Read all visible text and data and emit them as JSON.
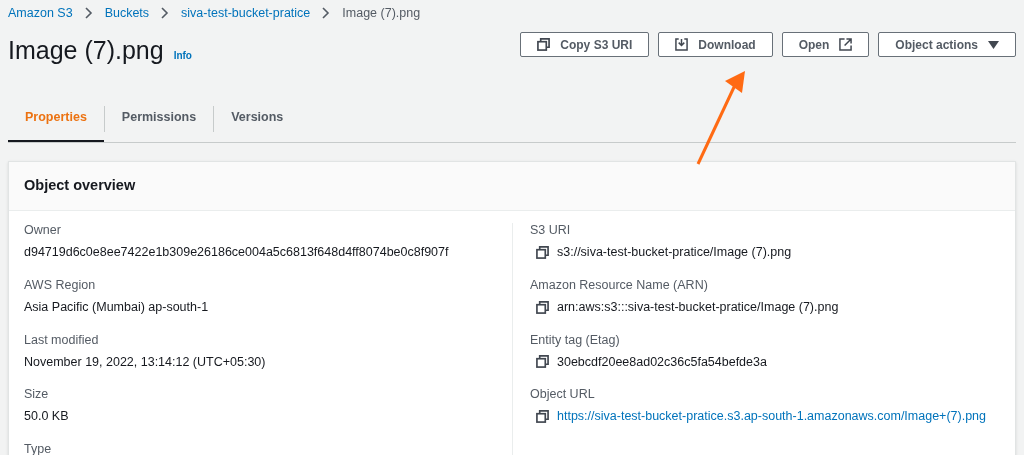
{
  "breadcrumbs": [
    {
      "label": "Amazon S3",
      "kind": "link"
    },
    {
      "label": "Buckets",
      "kind": "link"
    },
    {
      "label": "siva-test-bucket-pratice",
      "kind": "link"
    },
    {
      "label": "Image (7).png",
      "kind": "current"
    }
  ],
  "title": "Image (7).png",
  "info": "Info",
  "actions": [
    {
      "label": "Copy S3 URI"
    },
    {
      "label": "Download"
    },
    {
      "label": "Open"
    },
    {
      "label": "Object actions"
    }
  ],
  "tabs": [
    {
      "label": "Properties",
      "selected": true
    },
    {
      "label": "Permissions",
      "selected": false
    },
    {
      "label": "Versions",
      "selected": false
    }
  ],
  "overview": {
    "title": "Object overview",
    "left": [
      {
        "label": "Owner",
        "value": "d94719d6c0e8ee7422e1b309e26186ce004a5c6813f648d4ff8074be0c8f907f"
      },
      {
        "label": "AWS Region",
        "value": "Asia Pacific (Mumbai) ap-south-1"
      },
      {
        "label": "Last modified",
        "value": "November 19, 2022, 13:14:12 (UTC+05:30)"
      },
      {
        "label": "Size",
        "value": "50.0 KB"
      },
      {
        "label": "Type"
      }
    ],
    "right": [
      {
        "label": "S3 URI",
        "value": "s3://siva-test-bucket-pratice/Image (7).png",
        "kind": "copy"
      },
      {
        "label": "Amazon Resource Name (ARN)",
        "value": "arn:aws:s3:::siva-test-bucket-pratice/Image (7).png",
        "kind": "copy"
      },
      {
        "label": "Entity tag (Etag)",
        "value": "30ebcdf20ee8ad02c36c5fa54befde3a",
        "kind": "copy"
      },
      {
        "label": "Object URL",
        "value": "https://siva-test-bucket-pratice.s3.ap-south-1.amazonaws.com/Image+(7).png",
        "kind": "link"
      }
    ]
  }
}
